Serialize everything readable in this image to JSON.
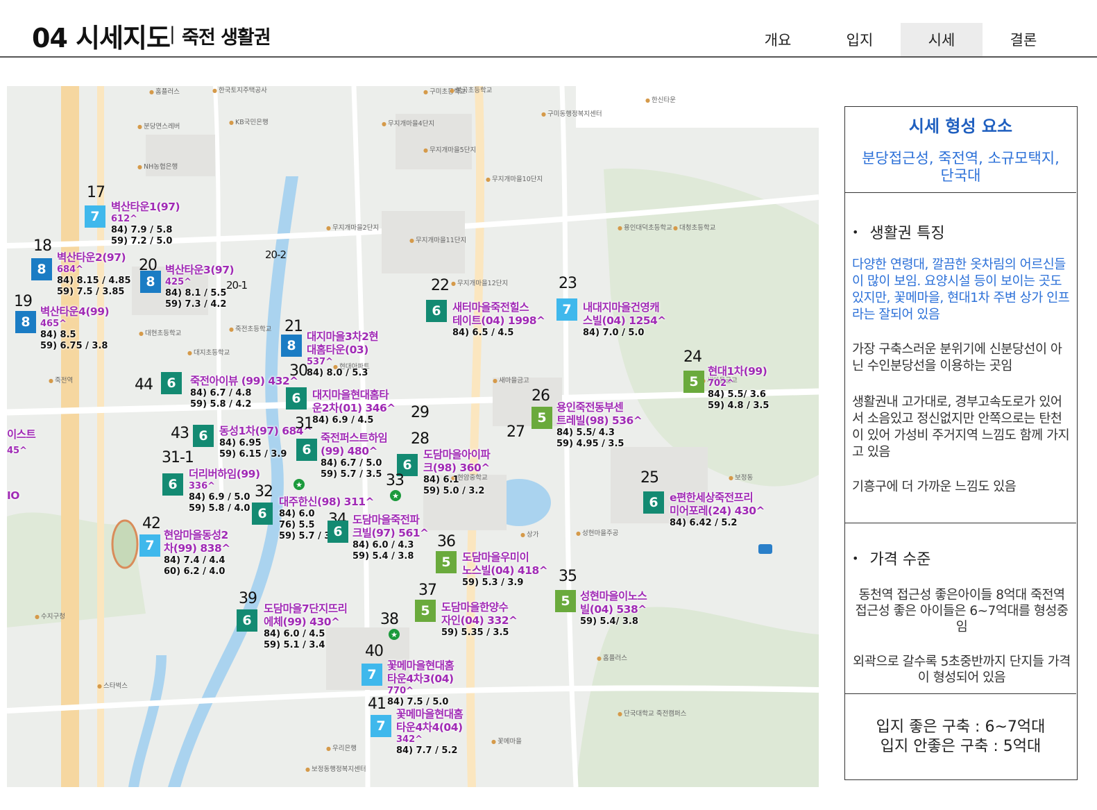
{
  "header": {
    "title_main": "04 시세지도",
    "title_sep": "|",
    "title_sub": "죽전 생활권",
    "tabs": [
      "개요",
      "입지",
      "시세",
      "결론"
    ],
    "active_tab": "시세"
  },
  "colors": {
    "badge_8": "#1a7cc4",
    "badge_7": "#3fb8ec",
    "badge_6": "#138a72",
    "badge_5": "#6aaa3c",
    "apt_name": "#a02ab5",
    "panel_blue": "#2b70d8"
  },
  "map": {
    "poi_labels": [
      "한국토지주택공사",
      "홈플러스",
      "분당면스레버",
      "KB국민은행",
      "NH농협은행",
      "무지개마을4단지",
      "무지개마을5단지",
      "구미초등학교",
      "불곡초등학교",
      "한신타운",
      "구미동행정복지센터",
      "무지개마을2단지",
      "무지개마을11단지",
      "무지개마을10단지",
      "무지개마을12단지",
      "현대아파트",
      "새마을금고",
      "죽전초등학교",
      "대현초등학교",
      "보정동",
      "꽃메마을",
      "새마을금고",
      "용인대덕초등학교",
      "대청초등학교",
      "상가",
      "현암중학교",
      "성현마을주공",
      "단국대학교 죽전캠퍼스",
      "죽전역",
      "홈플러스",
      "우리은행",
      "보정동행정복지센터",
      "수지구청",
      "스타벅스",
      "대지초등학교"
    ],
    "apartments": [
      {
        "num": "17",
        "size": "7",
        "name": "벽산타운1(97)",
        "households": "612^",
        "prices": [
          "84) 7.9 / 5.8",
          "59) 7.2 / 5.0"
        ]
      },
      {
        "num": "18",
        "size": "8",
        "name": "벽산타운2(97)",
        "households": "684^",
        "prices": [
          "84) 8.15 / 4.85",
          "59) 7.5 / 3.85"
        ]
      },
      {
        "num": "20",
        "size": "8",
        "name": "벽산타운3(97)",
        "households": "425^",
        "prices": [
          "84) 8.1 / 5.5",
          "59) 7.3 / 4.2"
        ]
      },
      {
        "num": "19",
        "size": "8",
        "name": "벽산타운4(99)",
        "households": "465^",
        "prices": [
          "84) 8.5",
          "59) 6.75 / 3.8"
        ]
      },
      {
        "num": "22",
        "size": "6",
        "name": "새터마을죽전힐스테이트(04) 1998^",
        "name_l1": "새터마을죽전힐스",
        "name_l2": "테이트(04) 1998^",
        "households": "",
        "prices": [
          "84) 6.5 / 4.5"
        ]
      },
      {
        "num": "23",
        "size": "7",
        "name": "내대지마을건영캐스빌(04) 1254^",
        "name_l1": "내대지마을건영캐",
        "name_l2": "스빌(04) 1254^",
        "households": "",
        "prices": [
          "84) 7.0 / 5.0"
        ]
      },
      {
        "num": "21",
        "size": "8",
        "name": "대지마을3차2현대홈타운(03)",
        "name_l1": "대지마을3차2현",
        "name_l2": "대홈타운(03)",
        "households": "537^",
        "prices": [
          "84) 8.0 / 5.3"
        ]
      },
      {
        "num": "24",
        "size": "5",
        "name": "현대1차(99)",
        "households": "702^",
        "prices": [
          "84) 5.5/ 3.6",
          "59) 4.8 / 3.5"
        ]
      },
      {
        "num": "44",
        "size": "6",
        "name": "죽전아이뷰 (99) 432^",
        "households": "",
        "prices": [
          "84) 6.7 / 4.8",
          "59) 5.8 / 4.2"
        ]
      },
      {
        "num": "30",
        "size": "6",
        "name": "대지마을현대홈타운2차(01) 346^",
        "name_l1": "대지마을현대홈타",
        "name_l2": "운2차(01) 346^",
        "households": "",
        "prices": [
          "84) 6.9 / 4.5"
        ]
      },
      {
        "num": "26",
        "size": "5",
        "name": "용인죽전동부센트레빌(98) 536^",
        "name_l1": "용인죽전동부센",
        "name_l2": "트레빌(98) 536^",
        "households": "",
        "prices": [
          "84) 5.5/ 4.3",
          "59) 4.95 / 3.5"
        ]
      },
      {
        "num": "43",
        "size": "6",
        "name": "동성1차(97) 684^",
        "households": "",
        "prices": [
          "84) 6.95",
          "59) 6.15 / 3.9"
        ]
      },
      {
        "num": "31",
        "size": "6",
        "name": "죽전퍼스트하임(99) 480^",
        "name_l1": "죽전퍼스트하임",
        "name_l2": "(99) 480^",
        "households": "",
        "prices": [
          "84) 6.7 / 5.0",
          "59) 5.7 / 3.5"
        ]
      },
      {
        "num": "28",
        "size": "6",
        "name": "도담마을아이파크(98) 360^",
        "name_l1": "도담마을아이파",
        "name_l2": "크(98) 360^",
        "households": "",
        "prices": [
          "84) 6.1",
          "59) 5.0 / 3.2"
        ]
      },
      {
        "num": "31-1",
        "size": "6",
        "name": "더리버하임(99)",
        "households": "336^",
        "prices": [
          "84) 6.9 / 5.0",
          "59) 5.8 / 4.0"
        ]
      },
      {
        "num": "32",
        "size": "6",
        "name": "대주한신(98) 311^",
        "households": "",
        "prices": [
          "84) 6.0",
          "76) 5.5",
          "59) 5.7 / 3.6"
        ]
      },
      {
        "num": "34",
        "size": "6",
        "name": "도담마을죽전파크빌(97) 561^",
        "name_l1": "도담마을죽전파",
        "name_l2": "크빌(97) 561^",
        "households": "",
        "prices": [
          "84) 6.0 / 4.3",
          "59) 5.4 / 3.8"
        ]
      },
      {
        "num": "25",
        "size": "6",
        "name": "e편한세상죽전프리미어포레(24) 430^",
        "name_l1": "e편한세상죽전프리",
        "name_l2": "미어포레(24) 430^",
        "households": "",
        "prices": [
          "84) 6.42 / 5.2"
        ]
      },
      {
        "num": "42",
        "size": "7",
        "name": "현암마을동성2차(99) 838^",
        "name_l1": "현암마을동성2",
        "name_l2": "차(99) 838^",
        "households": "",
        "prices": [
          "84) 7.4 / 4.4",
          "60) 6.2 / 4.0"
        ]
      },
      {
        "num": "36",
        "size": "5",
        "name": "도담마을우미이노스빌(04) 418^",
        "name_l1": "도담마을우미이",
        "name_l2": "노스빌(04) 418^",
        "households": "",
        "prices": [
          "59) 5.3 / 3.9"
        ]
      },
      {
        "num": "35",
        "size": "5",
        "name": "성현마을이노스빌(04) 538^",
        "name_l1": "성현마을이노스",
        "name_l2": "빌(04) 538^",
        "households": "",
        "prices": [
          "59) 5.4/ 3.8"
        ]
      },
      {
        "num": "39",
        "size": "6",
        "name": "도담마을7단지뜨리에체(99) 430^",
        "name_l1": "도담마을7단지뜨리",
        "name_l2": "에체(99) 430^",
        "households": "",
        "prices": [
          "84) 6.0 / 4.5",
          "59) 5.1 / 3.4"
        ]
      },
      {
        "num": "37",
        "size": "5",
        "name": "도담마을한양수자인(04) 332^",
        "name_l1": "도담마을한양수",
        "name_l2": "자인(04) 332^",
        "households": "",
        "prices": [
          "59) 5.35 / 3.5"
        ]
      },
      {
        "num": "40",
        "size": "7",
        "name": "꽃메마을현대홈타운4차3(04)",
        "name_l1": "꽃메마을현대홈",
        "name_l2": "타운4차3(04)",
        "households": "770^",
        "prices": [
          "84) 7.5 / 5.0"
        ]
      },
      {
        "num": "41",
        "size": "7",
        "name": "꽃메마을현대홈타운4차4(04)",
        "name_l1": "꽃메마을현대홈",
        "name_l2": "타운4차4(04)",
        "households": "342^",
        "prices": [
          "84) 7.7 / 5.2"
        ]
      }
    ],
    "edge_labels": [
      "이스트",
      "45^",
      "IO"
    ],
    "extra_nums": [
      "20-2",
      "20-1",
      "38",
      "29",
      "27",
      "33"
    ]
  },
  "panel": {
    "sec1_title": "시세 형성 요소",
    "sec1_sub": "분당접근성, 죽전역, 소규모택지, 단국대",
    "sec2_heading": "생활권 특징",
    "sec2_blue": "다양한 연령대, 깔끔한 옷차림의 어르신들이 많이 보임. 요양시설 등이 보이는 곳도 있지만, 꽃메마을, 현대1차 주변 상가 인프라는 잘되어 있음",
    "sec2_p1": "가장 구축스러운 분위기에 신분당선이 아닌 수인분당선을 이용하는 곳임",
    "sec2_p2": "생활권내 고가대로, 경부고속도로가 있어서 소음있고 정신없지만 안쪽으로는 탄천이 있어 가성비 주거지역 느낌도 함께 가지고 있음",
    "sec2_p3": "기흥구에 더 가까운 느낌도 있음",
    "sec3_heading": "가격 수준",
    "sec3_p1": "동천역 접근성 좋은아이들 8억대 죽전역 접근성 좋은 아이들은 6~7억대를 형성중임",
    "sec3_p2": "외곽으로 갈수록 5초중반까지 단지들 가격이 형성되어 있음",
    "sec4_l1": "입지 좋은 구축 : 6~7억대",
    "sec4_l2": "입지 안좋은 구축 : 5억대"
  }
}
